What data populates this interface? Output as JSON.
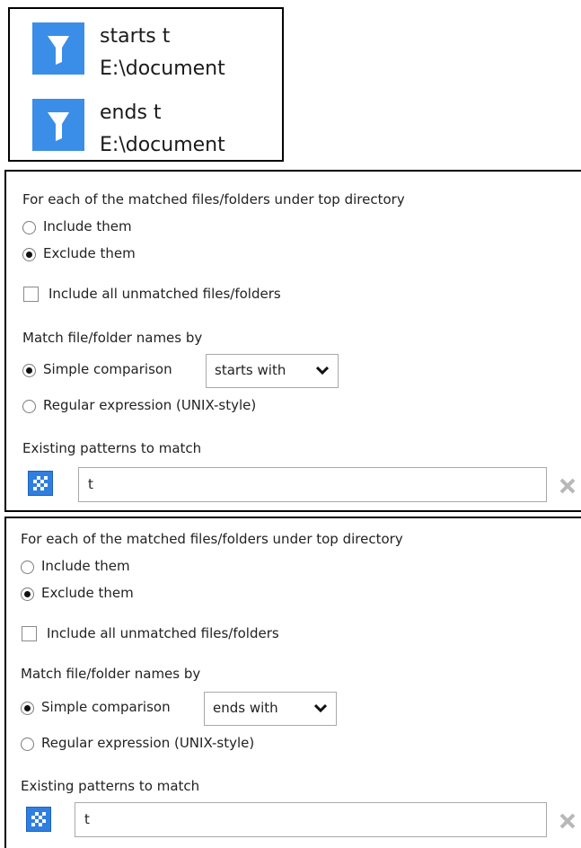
{
  "filters": [
    {
      "name": "starts t",
      "path": "E:\\document",
      "icon": "filter-icon"
    },
    {
      "name": "ends t",
      "path": "E:\\document",
      "icon": "filter-icon"
    }
  ],
  "panels": [
    {
      "heading": "For each of the matched files/folders under top directory",
      "include_label": "Include them",
      "exclude_label": "Exclude them",
      "action_selected": "exclude",
      "unmatched_label": "Include all unmatched files/folders",
      "unmatched_checked": false,
      "match_heading": "Match file/folder names by",
      "simple_label": "Simple comparison",
      "comparison_value": "starts with",
      "regex_label": "Regular expression (UNIX-style)",
      "mode_selected": "simple",
      "patterns_heading": "Existing patterns to match",
      "pattern_value": "t",
      "remove_icon": "close-icon"
    },
    {
      "heading": "For each of the matched files/folders under top directory",
      "include_label": "Include them",
      "exclude_label": "Exclude them",
      "action_selected": "exclude",
      "unmatched_label": "Include all unmatched files/folders",
      "unmatched_checked": false,
      "match_heading": "Match file/folder names by",
      "simple_label": "Simple comparison",
      "comparison_value": "ends with",
      "regex_label": "Regular expression (UNIX-style)",
      "mode_selected": "simple",
      "patterns_heading": "Existing patterns to match",
      "pattern_value": "t",
      "remove_icon": "close-icon"
    }
  ],
  "colors": {
    "filter_icon_bg": "#3b8ee8",
    "pattern_icon_bg": "#2f7fe0",
    "border": "#000000"
  }
}
